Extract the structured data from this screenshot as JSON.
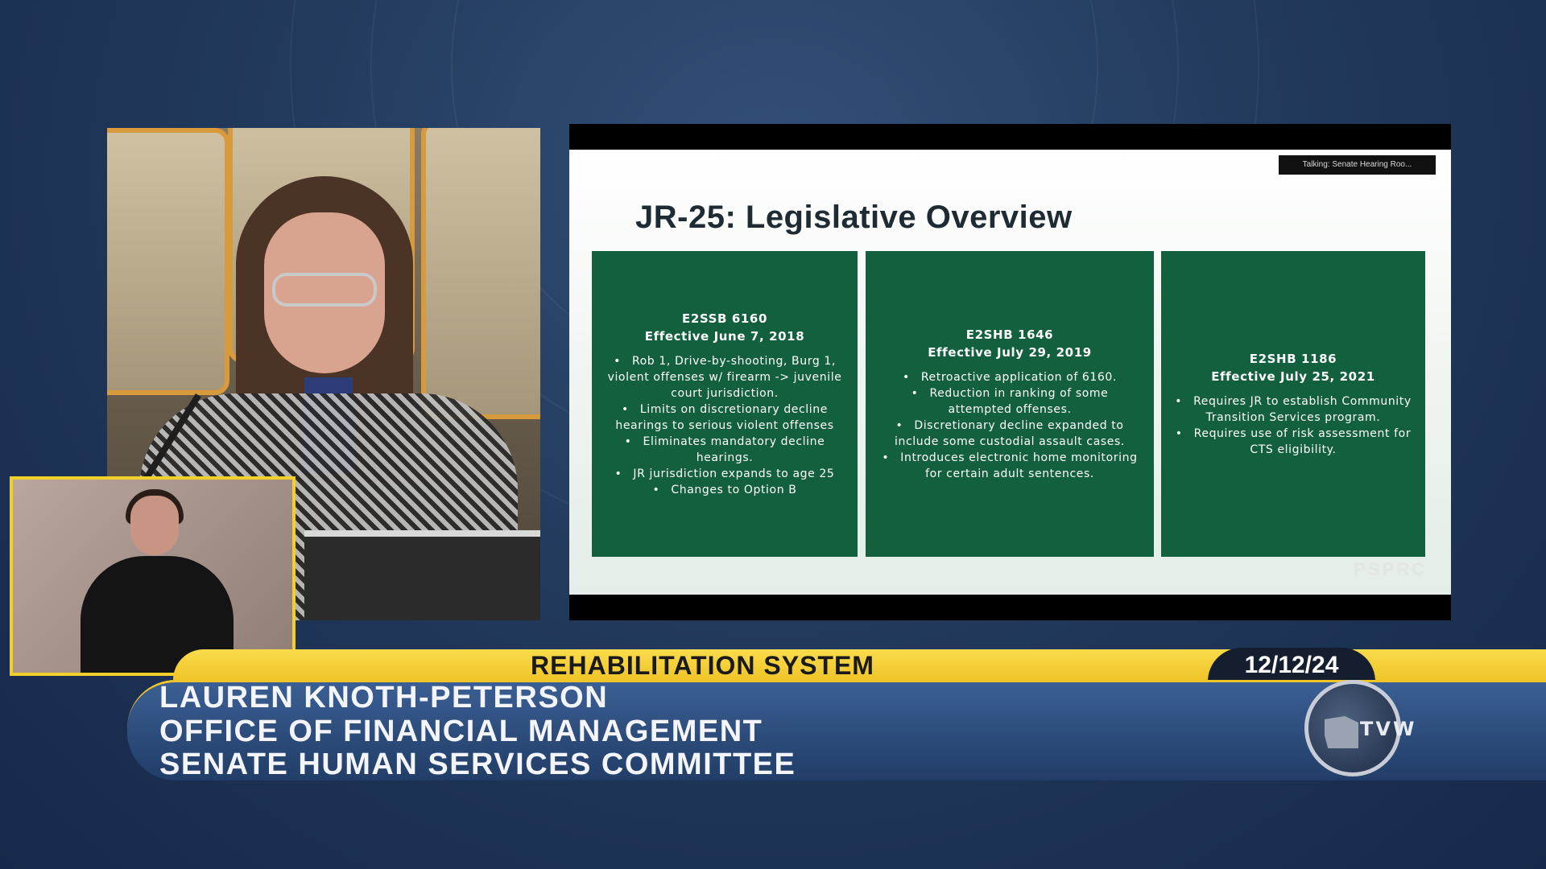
{
  "slide": {
    "badge": "Talking: Senate Hearing Roo...",
    "title": "JR-25: Legislative Overview",
    "cards": [
      {
        "bill": "E2SSB 6160",
        "effective": "Effective June 7, 2018",
        "items": [
          "Rob 1, Drive-by-shooting, Burg 1, violent offenses w/ firearm -> juvenile court jurisdiction.",
          "Limits on discretionary decline hearings to serious violent offenses",
          "Eliminates mandatory decline hearings.",
          "JR jurisdiction expands to age 25",
          "Changes to Option B"
        ]
      },
      {
        "bill": "E2SHB 1646",
        "effective": "Effective July 29, 2019",
        "items": [
          "Retroactive application of 6160.",
          "Reduction in ranking of some attempted offenses.",
          "Discretionary decline expanded to include some custodial assault cases.",
          "Introduces electronic home monitoring for certain adult sentences."
        ]
      },
      {
        "bill": "E2SHB 1186",
        "effective": "Effective July 25, 2021",
        "items": [
          "Requires JR to establish Community Transition Services program.",
          "Requires use of risk assessment for CTS eligibility."
        ]
      }
    ],
    "watermark": "PSPRC"
  },
  "lower_third": {
    "topic": "REHABILITATION SYSTEM",
    "date": "12/12/24",
    "name": "LAUREN KNOTH-PETERSON",
    "org": "OFFICE OF FINANCIAL MANAGEMENT",
    "committee": "SENATE HUMAN SERVICES COMMITTEE"
  },
  "logo": {
    "text": "TVW",
    "icon": "tvw-logo-icon"
  },
  "colors": {
    "slide_card_green": "#12603d",
    "banner_yellow": "#f0c52a",
    "banner_blue": "#2b4a78",
    "interpreter_border": "#f2cf2a"
  }
}
